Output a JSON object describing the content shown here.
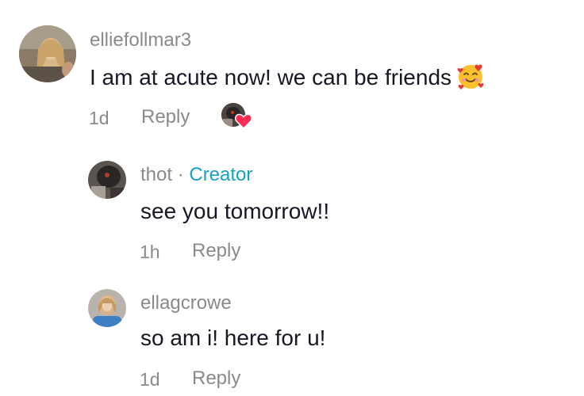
{
  "comments": [
    {
      "username": "elliefollmar3",
      "text": "I am at acute now! we can be friends",
      "emoji_icon": "smiling-face-with-hearts",
      "time": "1d",
      "reply_label": "Reply",
      "creator_liked": true
    },
    {
      "username": "thot",
      "separator": " · ",
      "badge": "Creator",
      "text": "see you tomorrow!!",
      "time": "1h",
      "reply_label": "Reply"
    },
    {
      "username": "ellagcrowe",
      "text": "so am i! here for u!",
      "time": "1d",
      "reply_label": "Reply"
    }
  ],
  "colors": {
    "username": "#8a8a8a",
    "text": "#161823",
    "creator_badge": "#18a1c4",
    "like_heart": "#fe2c55"
  }
}
